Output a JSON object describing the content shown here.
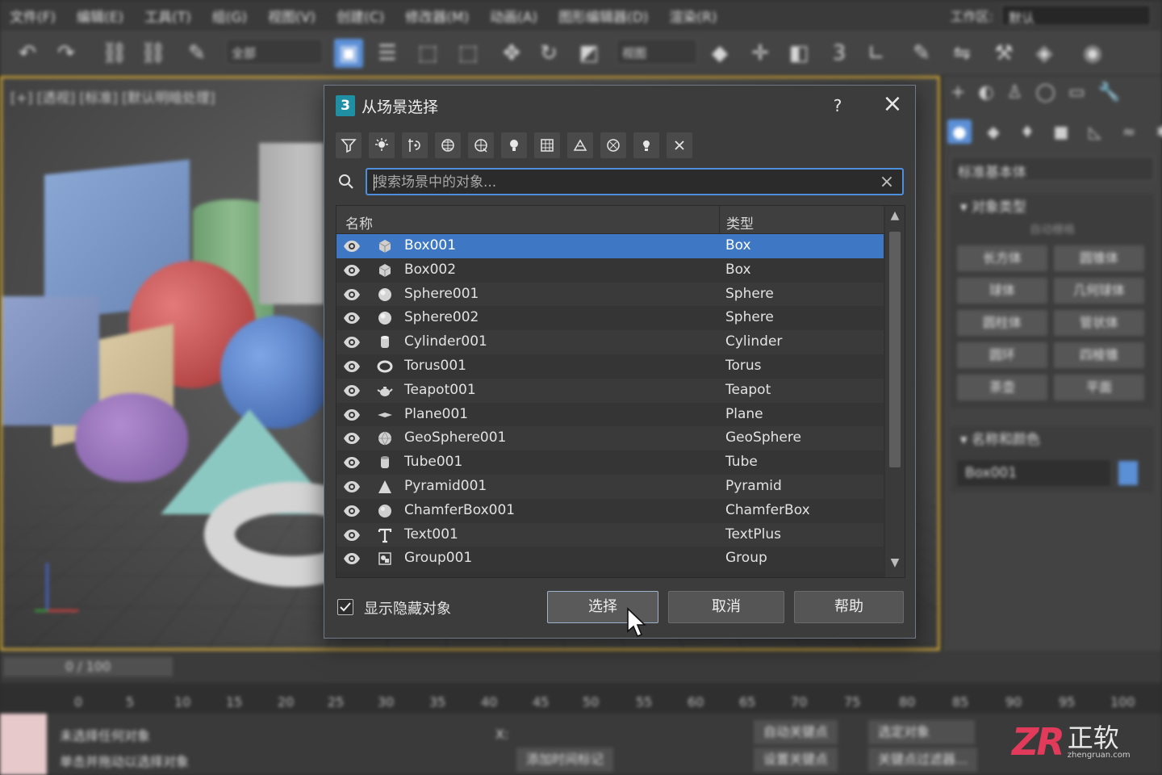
{
  "menubar": {
    "items": [
      "文件(F)",
      "编辑(E)",
      "工具(T)",
      "组(G)",
      "视图(V)",
      "创建(C)",
      "修改器(M)",
      "动画(A)",
      "图形编辑器(D)",
      "渲染(R)"
    ],
    "workspace_label": "工作区:",
    "workspace_value": "默认"
  },
  "toolbar": {
    "selection_filter": "全部",
    "view_ref": "视图"
  },
  "viewport": {
    "label": "[+] [透视] [标准] [默认明暗处理]"
  },
  "command_panel": {
    "category": "标准基本体",
    "object_type_title": "对象类型",
    "autogrid": "自动栅格",
    "primitives": [
      "长方体",
      "圆锥体",
      "球体",
      "几何球体",
      "圆柱体",
      "管状体",
      "圆环",
      "四棱锥",
      "茶壶",
      "平面"
    ],
    "name_color_title": "名称和颜色",
    "object_name": "Box001",
    "object_color": "#5b8fd6"
  },
  "timeline": {
    "frame": "0 / 100",
    "ticks": [
      "0",
      "5",
      "10",
      "15",
      "20",
      "25",
      "30",
      "35",
      "40",
      "45",
      "50",
      "55",
      "60",
      "65",
      "70",
      "75",
      "80",
      "85",
      "90",
      "95",
      "100"
    ]
  },
  "statusbar": {
    "line1": "未选择任何对象",
    "line2": "单击并拖动以选择对象",
    "add_time_tag": "添加时间标记",
    "auto_key": "自动关键点",
    "set_key": "设置关键点",
    "selected": "选定对象",
    "key_filters": "关键点过滤器...",
    "x_label": "X:"
  },
  "dialog": {
    "logo_text": "3",
    "title": "从场景选择",
    "help": "?",
    "search_placeholder": "搜索场景中的对象...",
    "columns": {
      "name": "名称",
      "type": "类型"
    },
    "rows": [
      {
        "name": "Box001",
        "type": "Box",
        "icon": "box-icon",
        "selected": true
      },
      {
        "name": "Box002",
        "type": "Box",
        "icon": "box-icon",
        "selected": false
      },
      {
        "name": "Sphere001",
        "type": "Sphere",
        "icon": "sphere-icon",
        "selected": false
      },
      {
        "name": "Sphere002",
        "type": "Sphere",
        "icon": "sphere-icon",
        "selected": false
      },
      {
        "name": "Cylinder001",
        "type": "Cylinder",
        "icon": "cylinder-icon",
        "selected": false
      },
      {
        "name": "Torus001",
        "type": "Torus",
        "icon": "torus-icon",
        "selected": false
      },
      {
        "name": "Teapot001",
        "type": "Teapot",
        "icon": "teapot-icon",
        "selected": false
      },
      {
        "name": "Plane001",
        "type": "Plane",
        "icon": "plane-icon",
        "selected": false
      },
      {
        "name": "GeoSphere001",
        "type": "GeoSphere",
        "icon": "geosphere-icon",
        "selected": false
      },
      {
        "name": "Tube001",
        "type": "Tube",
        "icon": "tube-icon",
        "selected": false
      },
      {
        "name": "Pyramid001",
        "type": "Pyramid",
        "icon": "pyramid-icon",
        "selected": false
      },
      {
        "name": "ChamferBox001",
        "type": "ChamferBox",
        "icon": "chamferbox-icon",
        "selected": false
      },
      {
        "name": "Text001",
        "type": "TextPlus",
        "icon": "text-icon",
        "selected": false
      },
      {
        "name": "Group001",
        "type": "Group",
        "icon": "group-icon",
        "selected": false
      }
    ],
    "show_hidden_label": "显示隐藏对象",
    "show_hidden_checked": true,
    "select_button": "选择",
    "cancel_button": "取消",
    "help_button": "帮助",
    "selection_color": "#3e78c4"
  },
  "watermark": {
    "brand": "ZR",
    "name": "正软",
    "url": "zhengruan.com"
  }
}
